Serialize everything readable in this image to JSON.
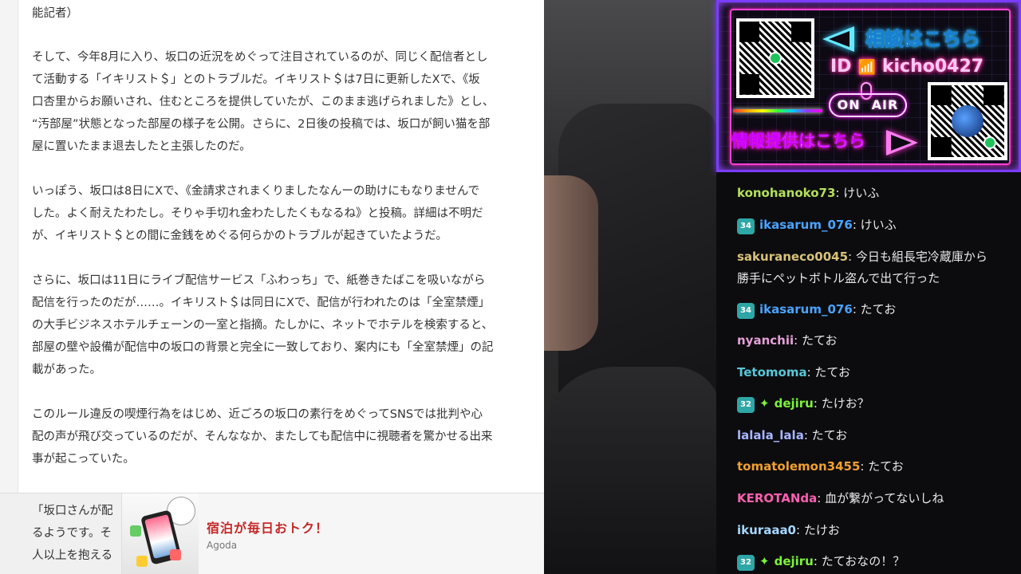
{
  "article": {
    "paragraphs": [
      {
        "lines": [
          "能記者）"
        ]
      },
      {
        "lines": [
          "そして、今年8月に入り、坂口の近況をめぐって注目されているのが、同じく配信者とし",
          "て活動する「イキリスト＄」とのトラブルだ。イキリスト＄は7日に更新したXで、《坂",
          "口杏里からお願いされ、住むところを提供していたが、このまま逃げられました》とし、",
          "“汚部屋”状態となった部屋の様子を公開。さらに、2日後の投稿では、坂口が飼い猫を部",
          "屋に置いたまま退去したと主張したのだ。"
        ]
      },
      {
        "lines": [
          "いっぽう、坂口は8日にXで、《金請求されまくりましたなんーの助けにもなりませんで",
          "した。よく耐えたわたし。そりゃ手切れ金わたしたくもなるね》と投稿。詳細は不明だ",
          "が、イキリスト＄との間に金銭をめぐる何らかのトラブルが起きていたようだ。"
        ]
      },
      {
        "lines": [
          "さらに、坂口は11日にライブ配信サービス「ふわっち」で、紙巻きたばこを吸いながら",
          "配信を行ったのだが……。イキリスト＄は同日にXで、配信が行われたのは「全室禁煙」",
          "の大手ビジネスホテルチェーンの一室と指摘。たしかに、ネットでホテルを検索すると、",
          "部屋の壁や設備が配信中の坂口の背景と完全に一致しており、案内にも「全室禁煙」の記",
          "載があった。"
        ]
      },
      {
        "lines": [
          "このルール違反の喫煙行為をはじめ、近ごろの坂口の素行をめぐってSNSでは批判や心",
          "配の声が飛び交っているのだが、そんななか、またしても配信中に視聴者を驚かせる出来",
          "事が起こっていた。"
        ]
      }
    ],
    "behind_ad_lines": [
      "「坂口さんが配",
      "るようです。そ",
      "人以上を抱える"
    ]
  },
  "ad": {
    "title": "宿泊が毎日おトク！",
    "brand": "Agoda"
  },
  "overlay": {
    "consult_text": "相談はこちら",
    "id_prefix": "ID",
    "id_value": "kicho0427",
    "onair_on": "ON",
    "onair_air": "AIR",
    "info_text": "情報提供はこちら"
  },
  "chat": {
    "messages": [
      {
        "user": "konohanoko73",
        "color": "#b4e05a",
        "text": "けいふ"
      },
      {
        "user": "ikasarum_076",
        "color": "#4aa3ff",
        "badge": "34",
        "text": "けいふ"
      },
      {
        "user": "sakuraneco0045",
        "color": "#d8c27a",
        "text": "今日も組長宅冷蔵庫から",
        "text2": "勝手にペットボトル盗んで出て行った"
      },
      {
        "user": "ikasarum_076",
        "color": "#4aa3ff",
        "badge": "34",
        "text": "たてお"
      },
      {
        "user": "nyanchii",
        "color": "#e6a0d8",
        "text": "たてお"
      },
      {
        "user": "Tetomoma",
        "color": "#57c7d8",
        "text": "たてお"
      },
      {
        "user": "dejiru",
        "color": "#7cf23a",
        "badge": "32",
        "spark": "✦",
        "text": "たけお？"
      },
      {
        "user": "lalala_lala",
        "color": "#a9b6ff",
        "text": "たてお"
      },
      {
        "user": "tomatolemon3455",
        "color": "#f0a030",
        "text": "たてお"
      },
      {
        "user": "KEROTANda",
        "color": "#ff5fb0",
        "text": "血が繋がってないしね"
      },
      {
        "user": "ikuraaa0",
        "color": "#a6d8ff",
        "text": "たけお"
      },
      {
        "user": "dejiru",
        "color": "#7cf23a",
        "badge": "32",
        "spark": "✦",
        "text": "たておなの！？"
      }
    ]
  }
}
